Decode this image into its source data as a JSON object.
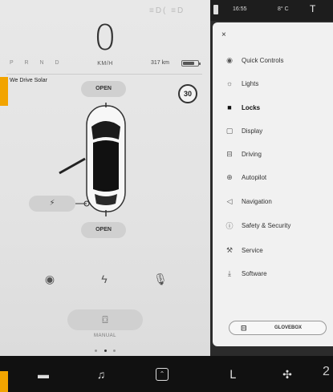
{
  "status": {
    "speed": "0",
    "speed_unit": "KM/H",
    "gear": "P R N D",
    "range": "317 km",
    "battery_level": 0.8,
    "speed_limit": "30",
    "top_icons": "≡D(   ≡D"
  },
  "car": {
    "solar_label": "We Drive Solar",
    "frunk_label": "OPEN",
    "trunk_label": "OPEN",
    "charge_icon": "bolt-icon"
  },
  "quick_row": {
    "dashcam_icon": "dashcam-icon",
    "charge_icon": "bolt-icon",
    "voice_icon": "microphone-icon"
  },
  "wipers": {
    "mode_label": "MANUAL",
    "icon": "wiper-icon"
  },
  "topbar_right": {
    "time": "16:55",
    "temperature": "8° C"
  },
  "menu": {
    "close_label": "×",
    "active": "Locks",
    "items": [
      {
        "label": "Quick Controls",
        "icon": "toggle-icon"
      },
      {
        "label": "Lights",
        "icon": "sun-icon"
      },
      {
        "label": "Locks",
        "icon": "lock-icon"
      },
      {
        "label": "Display",
        "icon": "display-icon"
      },
      {
        "label": "Driving",
        "icon": "car-icon"
      },
      {
        "label": "Autopilot",
        "icon": "steering-wheel-icon"
      },
      {
        "label": "Navigation",
        "icon": "navigation-arrow-icon"
      },
      {
        "label": "Safety & Security",
        "icon": "info-circle-icon"
      },
      {
        "label": "Service",
        "icon": "wrench-icon"
      },
      {
        "label": "Software",
        "icon": "download-icon"
      }
    ],
    "glovebox_label": "GLOVEBOX"
  },
  "bottom_bar": {
    "partial_number": "2"
  },
  "colors": {
    "accent_orange": "#f2a400"
  }
}
